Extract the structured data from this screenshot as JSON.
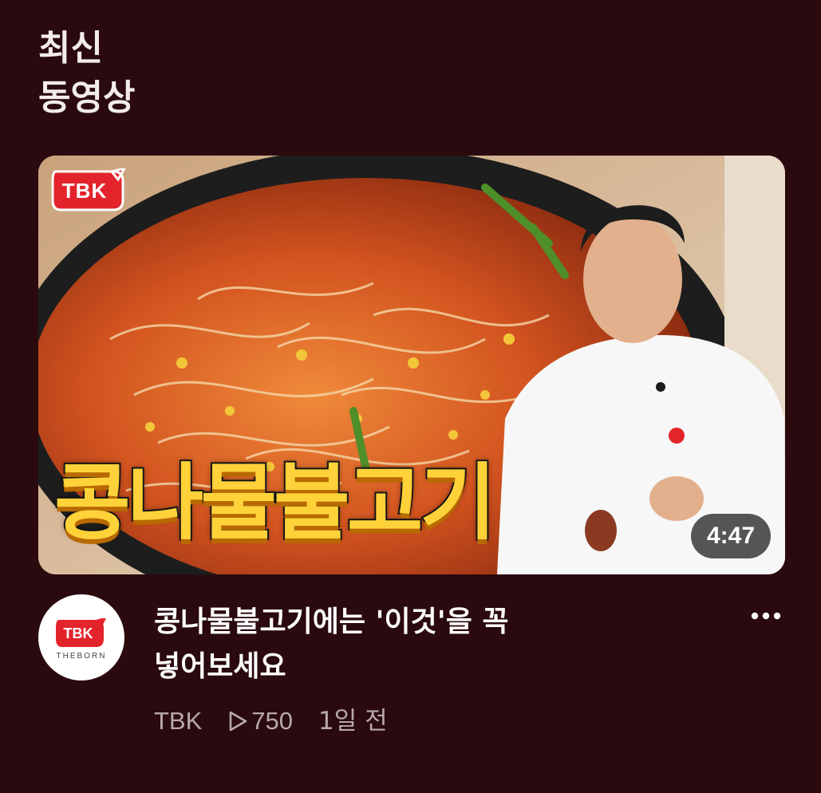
{
  "section": {
    "title_line1": "최신",
    "title_line2": "동영상"
  },
  "video": {
    "thumbnail": {
      "overlay_text": "콩나물불고기",
      "brand_badge": "TBK",
      "duration": "4:47"
    },
    "channel_avatar": {
      "logo_text": "TBK",
      "logo_subtext": "THEBORN"
    },
    "title_line1": "콩나물불고기에는 '이것'을 꼭",
    "title_line2": "넣어보세요",
    "channel_name": "TBK",
    "view_count": "750",
    "age": "1일 전",
    "more_icon": "more-horizontal-icon",
    "view_icon": "play-outline-icon"
  },
  "colors": {
    "background": "#2a0a0e",
    "brand_red": "#e3242b",
    "overlay_text_fill": "#ffd23a",
    "meta_text": "#b7a9aa"
  }
}
